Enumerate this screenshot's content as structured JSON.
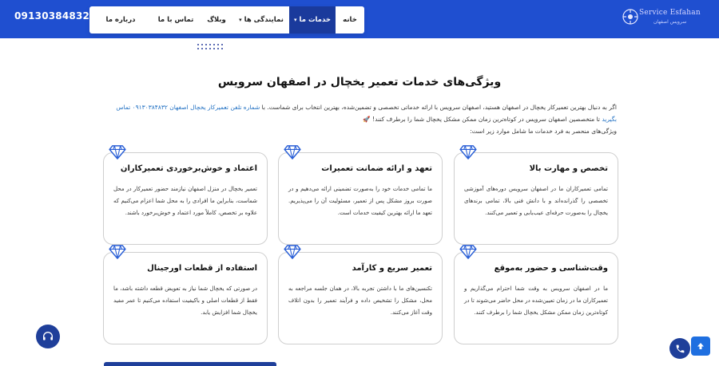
{
  "header": {
    "phone": "09130384832",
    "nav": [
      {
        "label": "خانه",
        "active": false,
        "dropdown": false
      },
      {
        "label": "خدمات ما",
        "active": true,
        "dropdown": true
      },
      {
        "label": "نمایندگی ها",
        "active": false,
        "dropdown": true
      },
      {
        "label": "وبلاگ",
        "active": false,
        "dropdown": false
      },
      {
        "label": "تماس با ما",
        "active": false,
        "dropdown": false
      },
      {
        "label": "درباره ما",
        "active": false,
        "dropdown": false
      }
    ],
    "logo": {
      "name": "Service Esfahan",
      "sub": "سرویس اصفهان"
    }
  },
  "main": {
    "title": "ویژگی‌های خدمات تعمیر یخچال در اصفهان سرویس",
    "intro_part1": "اگر به دنبال بهترین تعمیرکار یخچال در اصفهان هستید، اصفهان سرویس با ارائه خدماتی تخصصی و تضمین‌شده، بهترین انتخاب برای شماست. با ",
    "intro_link": "شماره تلفن تعمیرکار یخچال اصفهان ۰۹۱۳۰۳۸۴۸۳۲ تماس بگیرید",
    "intro_part2": " تا متخصصین اصفهان سرویس در کوتاه‌ترین زمان ممکن مشکل یخچال شما را برطرف کنند! 🚀",
    "intro_line3": "ویژگی‌های منحصر به فرد خدمات ما شامل موارد زیر است:",
    "cards": [
      {
        "title": "تخصص و مهارت بالا",
        "text": "تمامی تعمیرکاران ما در اصفهان سرویس دوره‌های آموزشی تخصصی را گذرانده‌اند و با دانش فنی بالا، تمامی برندهای یخچال را به‌صورت حرفه‌ای عیب‌یابی و تعمیر می‌کنند."
      },
      {
        "title": "تعهد و ارائه ضمانت تعمیرات",
        "text": "ما تمامی خدمات خود را به‌صورت تضمینی ارائه می‌دهیم و در صورت بروز مشکل پس از تعمیر، مسئولیت آن را می‌پذیریم. تعهد ما ارائه بهترین کیفیت خدمات است."
      },
      {
        "title": "اعتماد و خوش‌برخوردی تعمیرکاران",
        "text": "تعمیر یخچال در منزل اصفهان نیازمند حضور تعمیرکار در محل شماست، بنابراین ما افرادی را به محل شما اعزام می‌کنیم که علاوه بر تخصص، کاملاً مورد اعتماد و خوش‌برخورد باشند."
      },
      {
        "title": "وقت‌شناسی و حضور به‌موقع",
        "text": "ما در اصفهان سرویس به وقت شما احترام می‌گذاریم و تعمیرکاران ما در زمان تعیین‌شده در محل حاضر می‌شوند تا در کوتاه‌ترین زمان ممکن مشکل یخچال شما را برطرف کنند."
      },
      {
        "title": "تعمیر سریع و کارآمد",
        "text": "تکنسین‌های ما با داشتن تجربه بالا، در همان جلسه مراجعه به محل، مشکل را تشخیص داده و فرآیند تعمیر را بدون اتلاف وقت آغاز می‌کنند."
      },
      {
        "title": "استفاده از قطعات اورجینال",
        "text": "در صورتی که یخچال شما نیاز به تعویض قطعه داشته باشد، ما فقط از قطعات اصلی و باکیفیت استفاده می‌کنیم تا عمر مفید یخچال شما افزایش یابد."
      }
    ]
  },
  "icons": {
    "card_icon": "diamond-icon",
    "support": "headset-icon",
    "call": "phone-icon",
    "scroll_top": "arrow-up-icon"
  },
  "colors": {
    "header": "#1f4fd0",
    "active_nav": "#1a3a9c",
    "link": "#1f6fc2",
    "diamond": "#2a5fd6"
  }
}
